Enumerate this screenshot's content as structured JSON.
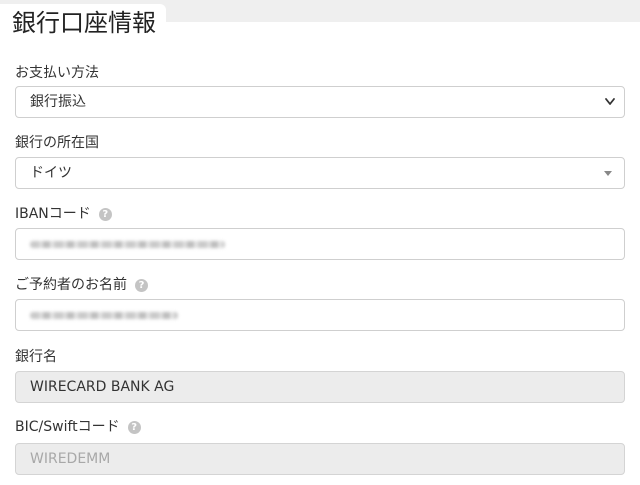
{
  "section": {
    "title": "銀行口座情報"
  },
  "payment_method": {
    "label": "お支払い方法",
    "value": "銀行振込"
  },
  "bank_country": {
    "label": "銀行の所在国",
    "value": "ドイツ"
  },
  "iban": {
    "label": "IBANコード",
    "help_icon": "?"
  },
  "account_holder": {
    "label": "ご予約者のお名前",
    "help_icon": "?"
  },
  "bank_name": {
    "label": "銀行名",
    "value": "WIRECARD BANK AG"
  },
  "bic": {
    "label": "BIC/Swiftコード",
    "help_icon": "?",
    "value": "WIREDEMM"
  }
}
